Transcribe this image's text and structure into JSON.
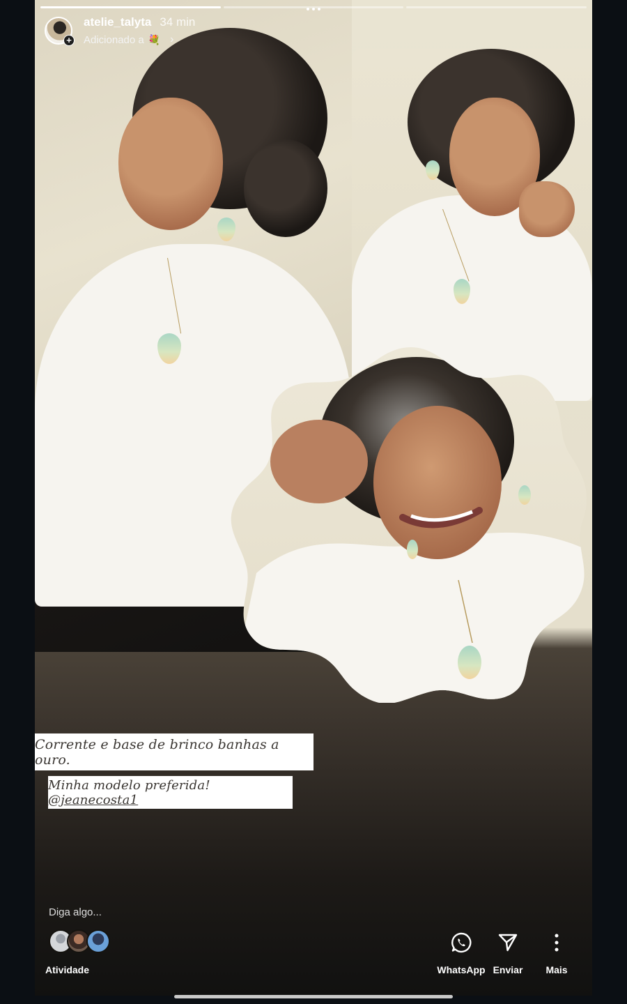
{
  "story": {
    "progress": [
      1.0,
      0.0,
      0.0
    ],
    "username": "atelie_talyta",
    "time": "34 min",
    "added_to": "Adicionado a",
    "added_to_icon": "bouquet-emoji"
  },
  "captions": {
    "line1": "Corrente e base de brinco banhas a ouro.",
    "line2_prefix": "Minha modelo preferida!",
    "line2_mention": "@jeanecosta1"
  },
  "footer": {
    "reply_placeholder": "Diga algo...",
    "activity_label": "Atividade",
    "actions": {
      "whatsapp": "WhatsApp",
      "send": "Enviar",
      "more": "Mais"
    }
  },
  "colors": {
    "accent_white": "#ffffff",
    "background": "#0b0f14"
  }
}
